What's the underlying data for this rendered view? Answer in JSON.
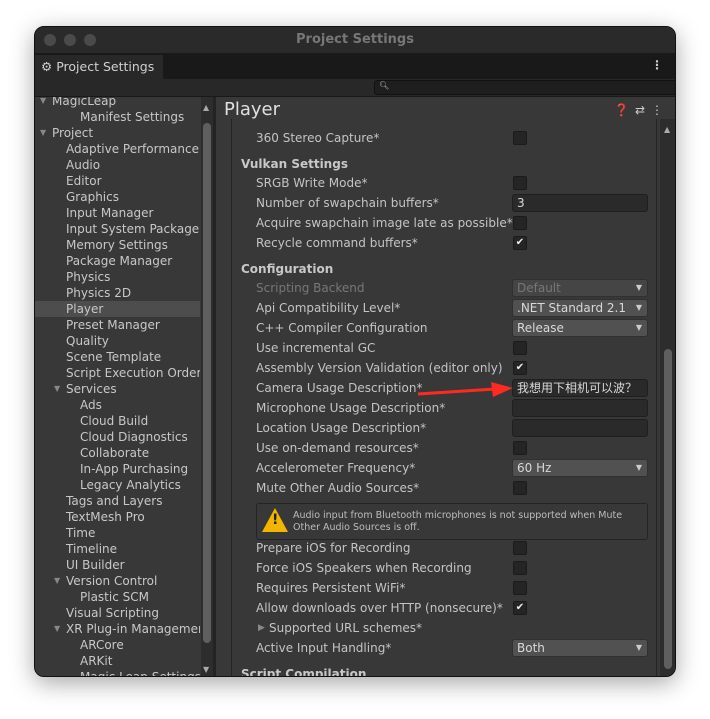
{
  "window": {
    "title": "Project Settings",
    "tab_label": "Project Settings",
    "tab_icon": "gear-icon",
    "search_placeholder": ""
  },
  "sidebar": {
    "items": [
      {
        "label": "MagicLeap",
        "level": 0,
        "expanded": true
      },
      {
        "label": "Manifest Settings",
        "level": 2
      },
      {
        "label": "Project",
        "level": 0,
        "expanded": true
      },
      {
        "label": "Adaptive Performance",
        "level": 1
      },
      {
        "label": "Audio",
        "level": 1
      },
      {
        "label": "Editor",
        "level": 1
      },
      {
        "label": "Graphics",
        "level": 1
      },
      {
        "label": "Input Manager",
        "level": 1
      },
      {
        "label": "Input System Package",
        "level": 1
      },
      {
        "label": "Memory Settings",
        "level": 1
      },
      {
        "label": "Package Manager",
        "level": 1
      },
      {
        "label": "Physics",
        "level": 1
      },
      {
        "label": "Physics 2D",
        "level": 1
      },
      {
        "label": "Player",
        "level": 1,
        "selected": true
      },
      {
        "label": "Preset Manager",
        "level": 1
      },
      {
        "label": "Quality",
        "level": 1
      },
      {
        "label": "Scene Template",
        "level": 1
      },
      {
        "label": "Script Execution Order",
        "level": 1
      },
      {
        "label": "Services",
        "level": 1,
        "expanded": true
      },
      {
        "label": "Ads",
        "level": 2
      },
      {
        "label": "Cloud Build",
        "level": 2
      },
      {
        "label": "Cloud Diagnostics",
        "level": 2
      },
      {
        "label": "Collaborate",
        "level": 2
      },
      {
        "label": "In-App Purchasing",
        "level": 2
      },
      {
        "label": "Legacy Analytics",
        "level": 2
      },
      {
        "label": "Tags and Layers",
        "level": 1
      },
      {
        "label": "TextMesh Pro",
        "level": 1
      },
      {
        "label": "Time",
        "level": 1
      },
      {
        "label": "Timeline",
        "level": 1
      },
      {
        "label": "UI Builder",
        "level": 1
      },
      {
        "label": "Version Control",
        "level": 1,
        "expanded": true
      },
      {
        "label": "Plastic SCM",
        "level": 2
      },
      {
        "label": "Visual Scripting",
        "level": 1
      },
      {
        "label": "XR Plug-in Management",
        "level": 1,
        "expanded": true
      },
      {
        "label": "ARCore",
        "level": 2
      },
      {
        "label": "ARKit",
        "level": 2
      },
      {
        "label": "Magic Leap Settings",
        "level": 2
      }
    ]
  },
  "main": {
    "title": "Player",
    "header_icons": [
      "help-icon",
      "presets-icon",
      "kebab-icon"
    ],
    "rows": [
      {
        "type": "checkbox",
        "label": "360 Stereo Capture*",
        "checked": false
      },
      {
        "type": "header",
        "label": "Vulkan Settings"
      },
      {
        "type": "checkbox",
        "label": "SRGB Write Mode*",
        "checked": false
      },
      {
        "type": "field",
        "label": "Number of swapchain buffers*",
        "value": "3"
      },
      {
        "type": "checkbox",
        "label": "Acquire swapchain image late as possible*",
        "checked": false
      },
      {
        "type": "checkbox",
        "label": "Recycle command buffers*",
        "checked": true
      },
      {
        "type": "header",
        "label": "Configuration"
      },
      {
        "type": "dropdown",
        "label": "Scripting Backend",
        "value": "Default",
        "disabled": true
      },
      {
        "type": "dropdown",
        "label": "Api Compatibility Level*",
        "value": ".NET Standard 2.1"
      },
      {
        "type": "dropdown",
        "label": "C++ Compiler Configuration",
        "value": "Release"
      },
      {
        "type": "checkbox",
        "label": "Use incremental GC",
        "checked": false
      },
      {
        "type": "checkbox",
        "label": "Assembly Version Validation (editor only)",
        "checked": true
      },
      {
        "type": "field",
        "label": "Camera Usage Description*",
        "value": "我想用下相机可以波？",
        "annotated": true
      },
      {
        "type": "field",
        "label": "Microphone Usage Description*",
        "value": ""
      },
      {
        "type": "field",
        "label": "Location Usage Description*",
        "value": ""
      },
      {
        "type": "checkbox",
        "label": "Use on-demand resources*",
        "checked": false
      },
      {
        "type": "dropdown",
        "label": "Accelerometer Frequency*",
        "value": "60 Hz"
      },
      {
        "type": "checkbox",
        "label": "Mute Other Audio Sources*",
        "checked": false
      },
      {
        "type": "warning",
        "label": "Audio input from Bluetooth microphones is not supported when Mute Other Audio Sources is off."
      },
      {
        "type": "checkbox",
        "label": "Prepare iOS for Recording",
        "checked": false
      },
      {
        "type": "checkbox",
        "label": "Force iOS Speakers when Recording",
        "checked": false
      },
      {
        "type": "checkbox",
        "label": "Requires Persistent WiFi*",
        "checked": false
      },
      {
        "type": "checkbox",
        "label": "Allow downloads over HTTP (nonsecure)*",
        "checked": true
      },
      {
        "type": "foldout",
        "label": "Supported URL schemes*"
      },
      {
        "type": "dropdown",
        "label": "Active Input Handling*",
        "value": "Both"
      },
      {
        "type": "header",
        "label": "Script Compilation"
      }
    ]
  },
  "colors": {
    "annotation_arrow": "#ff2a1f",
    "warning": "#f3b600",
    "selected_row": "#4d4d4d"
  }
}
